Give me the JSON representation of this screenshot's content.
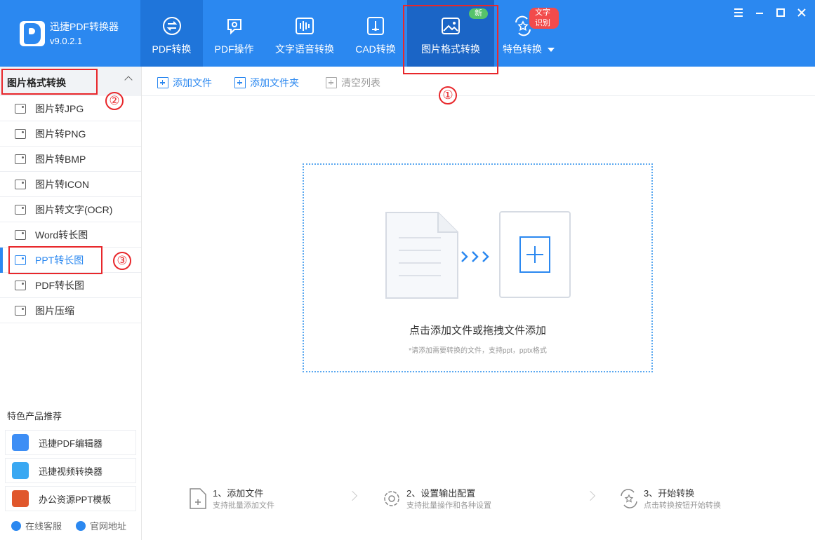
{
  "app": {
    "name": "迅捷PDF转换器",
    "version": "v9.0.2.1"
  },
  "nav": [
    {
      "label": "PDF转换",
      "icon": "convert-icon"
    },
    {
      "label": "PDF操作",
      "icon": "gear-icon"
    },
    {
      "label": "文字语音转换",
      "icon": "audio-wave-icon"
    },
    {
      "label": "CAD转换",
      "icon": "cad-icon"
    },
    {
      "label": "图片格式转换",
      "icon": "image-icon",
      "badge": "新"
    },
    {
      "label": "特色转换",
      "icon": "star-icon",
      "badge": "文字识别"
    }
  ],
  "sidebar": {
    "title": "图片格式转换",
    "items": [
      {
        "label": "图片转JPG"
      },
      {
        "label": "图片转PNG"
      },
      {
        "label": "图片转BMP"
      },
      {
        "label": "图片转ICON"
      },
      {
        "label": "图片转文字(OCR)"
      },
      {
        "label": "Word转长图"
      },
      {
        "label": "PPT转长图"
      },
      {
        "label": "PDF转长图"
      },
      {
        "label": "图片压缩"
      }
    ],
    "active_index": 6,
    "recommend_title": "特色产品推荐",
    "recommend": [
      {
        "label": "迅捷PDF编辑器"
      },
      {
        "label": "迅捷视频转换器"
      },
      {
        "label": "办公资源PPT模板"
      }
    ],
    "footer": {
      "service": "在线客服",
      "website": "官网地址"
    }
  },
  "toolbar": {
    "add_file": "添加文件",
    "add_folder": "添加文件夹",
    "clear_list": "清空列表"
  },
  "dropzone": {
    "main": "点击添加文件或拖拽文件添加",
    "hint": "*请添加需要转换的文件，支持ppt，pptx格式"
  },
  "steps": [
    {
      "title": "1、添加文件",
      "desc": "支持批量添加文件"
    },
    {
      "title": "2、设置输出配置",
      "desc": "支持批量操作和各种设置"
    },
    {
      "title": "3、开始转换",
      "desc": "点击转换按钮开始转换"
    }
  ],
  "annotations": [
    "①",
    "②",
    "③"
  ],
  "colors": {
    "brand": "#2b88f0",
    "annotation": "#e8272b"
  }
}
